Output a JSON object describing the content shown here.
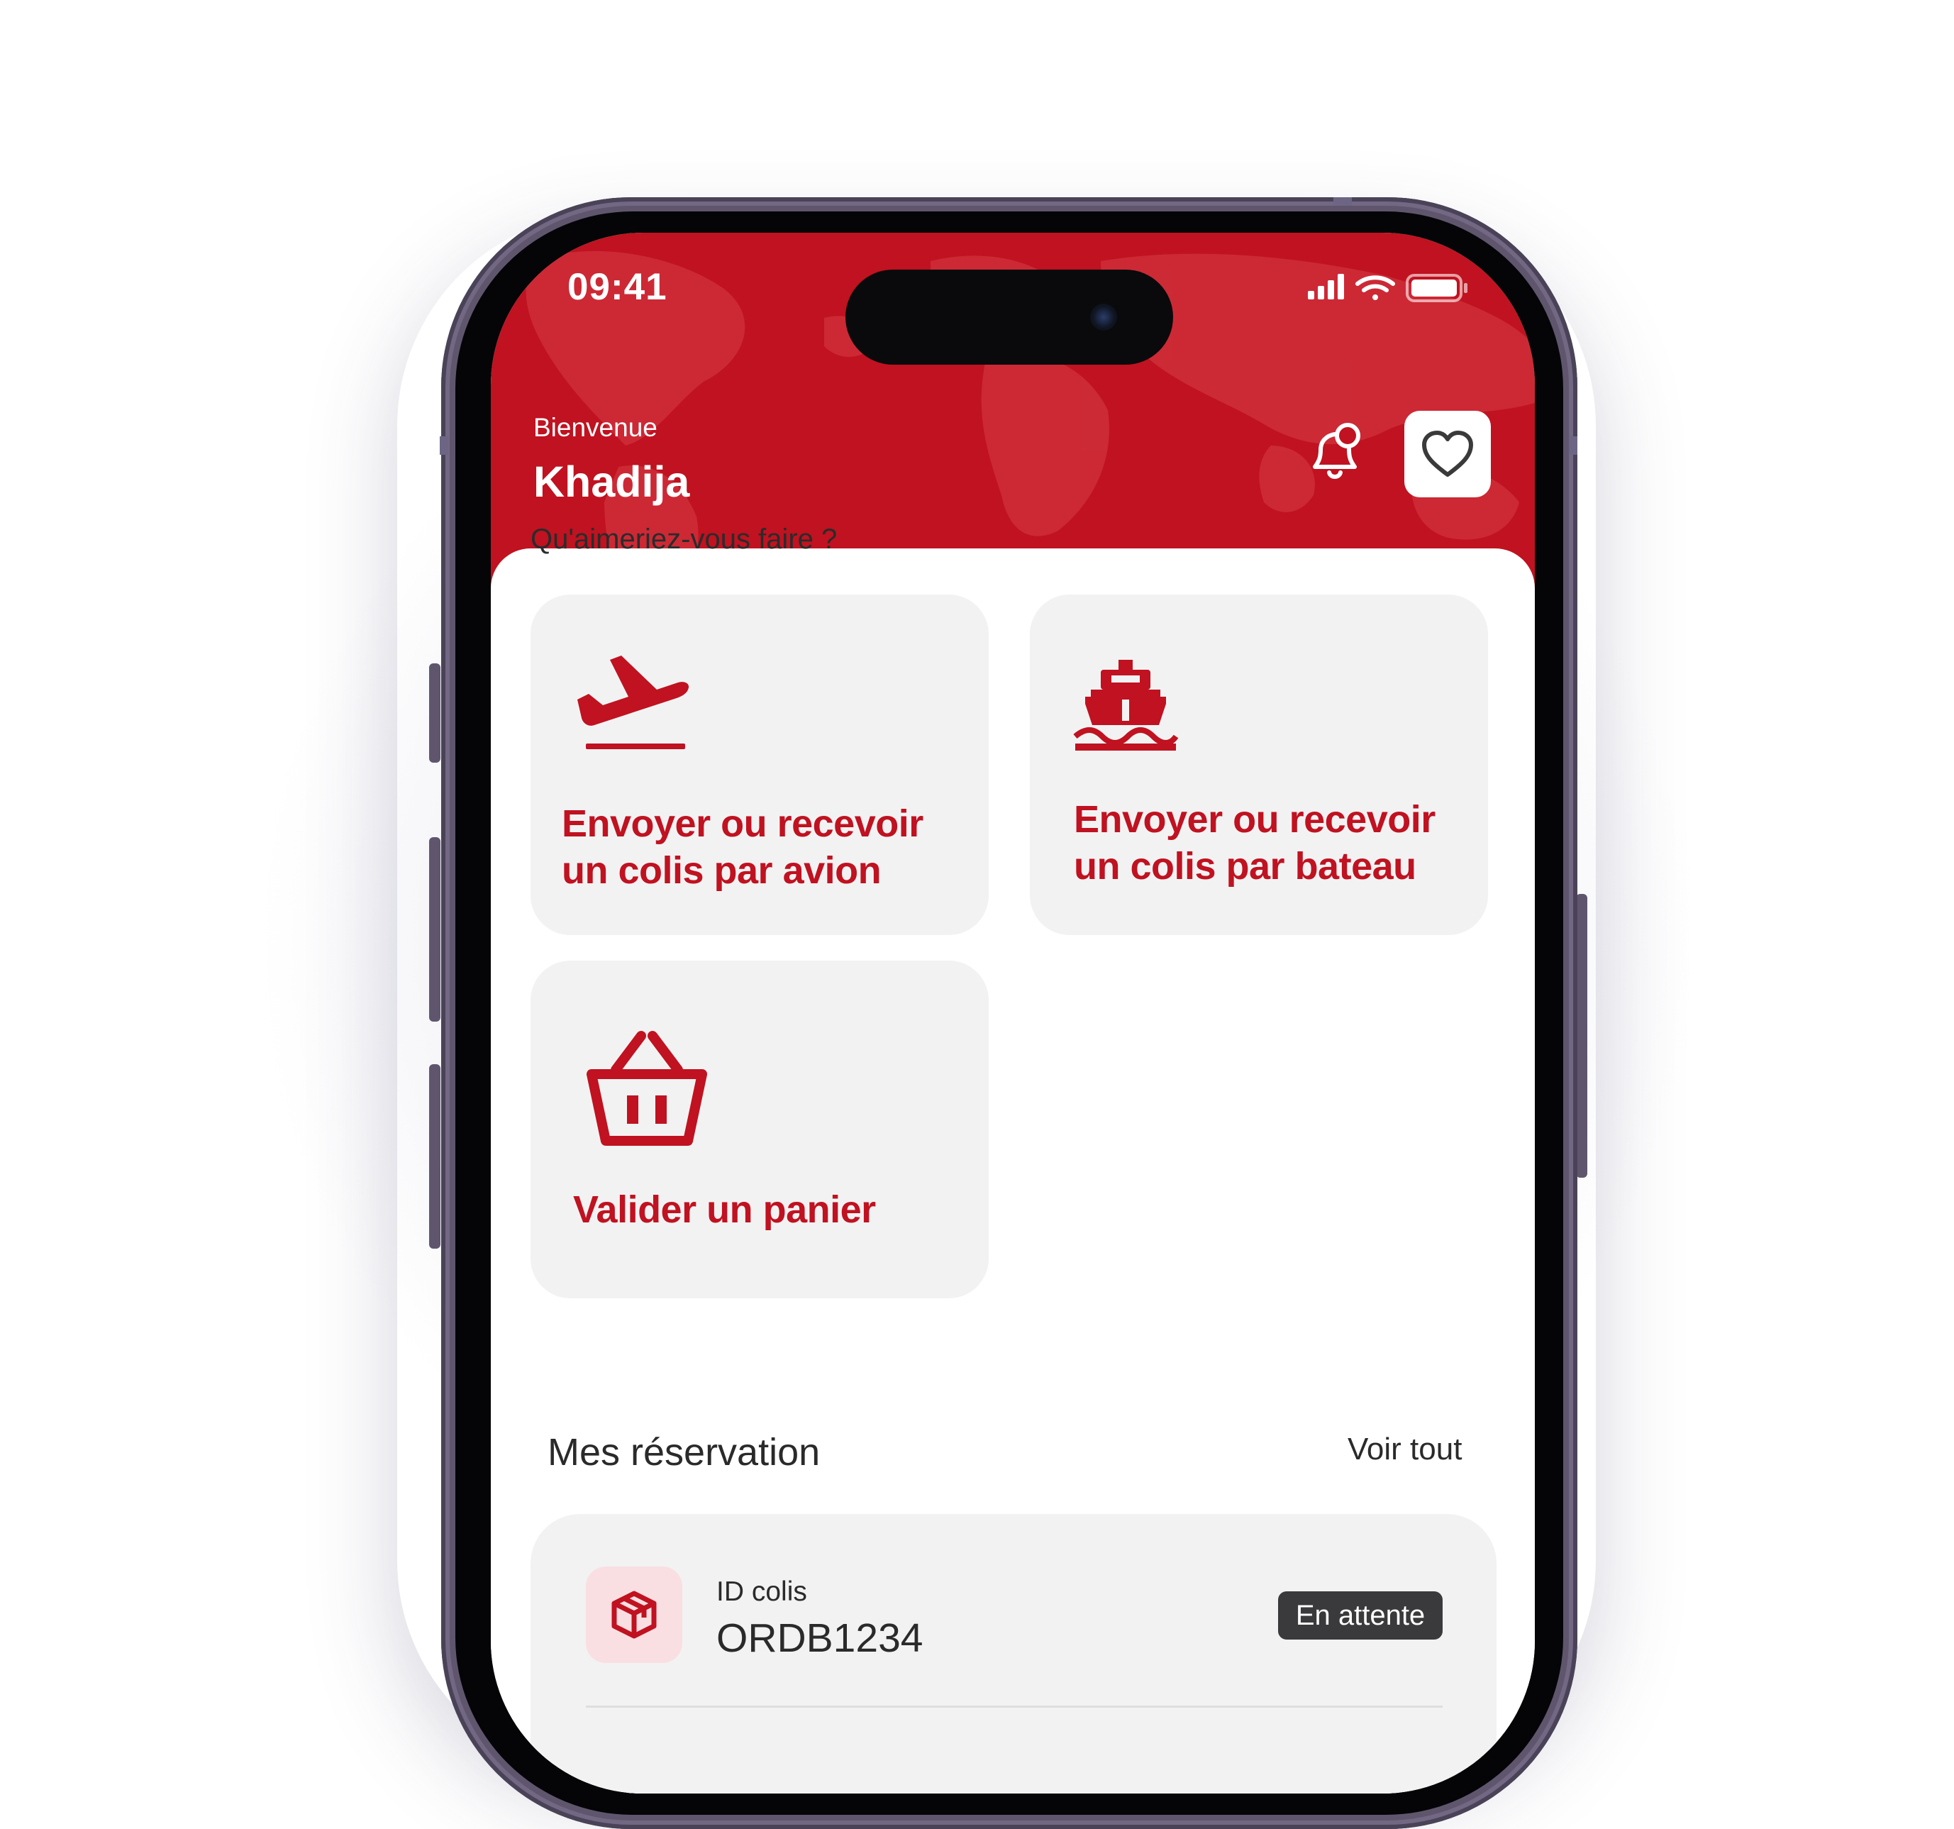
{
  "status_bar": {
    "time": "09:41"
  },
  "header": {
    "welcome": "Bienvenue",
    "user_name": "Khadija",
    "accent_color": "#c01220"
  },
  "prompt": "Qu'aimeriez-vous faire ?",
  "actions": [
    {
      "label_line1": "Envoyer ou recevoir",
      "label_line2": "un colis par avion",
      "icon": "airplane-takeoff-icon"
    },
    {
      "label_line1": "Envoyer ou recevoir",
      "label_line2": "un colis par bateau",
      "icon": "ship-icon"
    },
    {
      "label_line1": "Valider un panier",
      "icon": "basket-icon"
    }
  ],
  "reservations": {
    "title": "Mes réservation",
    "see_all": "Voir tout",
    "items": [
      {
        "id_label": "ID colis",
        "id": "ORDB1234",
        "status": "En attente",
        "icon": "package-icon"
      }
    ]
  }
}
